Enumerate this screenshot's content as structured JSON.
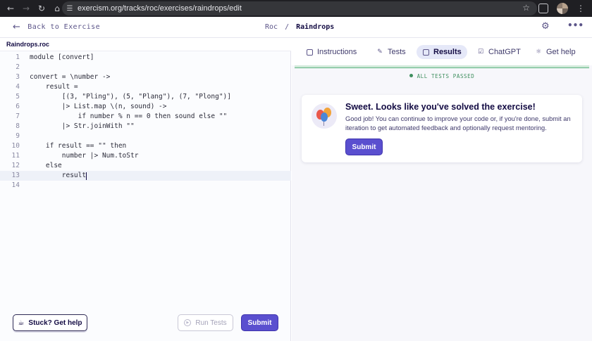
{
  "browser": {
    "url": "exercism.org/tracks/roc/exercises/raindrops/edit"
  },
  "header": {
    "back_label": "Back to Exercise",
    "breadcrumb_track": "Roc",
    "breadcrumb_sep": "/",
    "breadcrumb_exercise": "Raindrops"
  },
  "editor": {
    "filename": "Raindrops.roc",
    "lines": [
      {
        "n": "1",
        "text": "module [convert]"
      },
      {
        "n": "2",
        "text": ""
      },
      {
        "n": "3",
        "text": "convert = \\number ->"
      },
      {
        "n": "4",
        "text": "    result ="
      },
      {
        "n": "5",
        "text": "        [(3, \"Pling\"), (5, \"Plang\"), (7, \"Plong\")]"
      },
      {
        "n": "6",
        "text": "        |> List.map \\(n, sound) ->"
      },
      {
        "n": "7",
        "text": "            if number % n == 0 then sound else \"\""
      },
      {
        "n": "8",
        "text": "        |> Str.joinWith \"\""
      },
      {
        "n": "9",
        "text": ""
      },
      {
        "n": "10",
        "text": "    if result == \"\" then"
      },
      {
        "n": "11",
        "text": "        number |> Num.toStr"
      },
      {
        "n": "12",
        "text": "    else"
      },
      {
        "n": "13",
        "text": "        result"
      },
      {
        "n": "14",
        "text": ""
      }
    ],
    "active_line": "13"
  },
  "footer": {
    "stuck_label": "Stuck? Get help",
    "run_tests_label": "Run Tests",
    "submit_label": "Submit"
  },
  "tabs": [
    {
      "label": "Instructions",
      "icon": "instructions-icon",
      "selected": false
    },
    {
      "label": "Tests",
      "icon": "tests-icon",
      "selected": false
    },
    {
      "label": "Results",
      "icon": "results-icon",
      "selected": true
    },
    {
      "label": "ChatGPT",
      "icon": "chatgpt-icon",
      "selected": false
    },
    {
      "label": "Get help",
      "icon": "help-icon",
      "selected": false
    }
  ],
  "results": {
    "status": "ALL TESTS PASSED",
    "title": "Sweet. Looks like you've solved the exercise!",
    "body": "Good job! You can continue to improve your code or, if you're done, submit an iteration to get automated feedback and optionally request mentoring.",
    "submit_label": "Submit"
  },
  "colors": {
    "accent": "#5a4fcf",
    "success": "#3f8f5f",
    "text": "#130b43"
  }
}
